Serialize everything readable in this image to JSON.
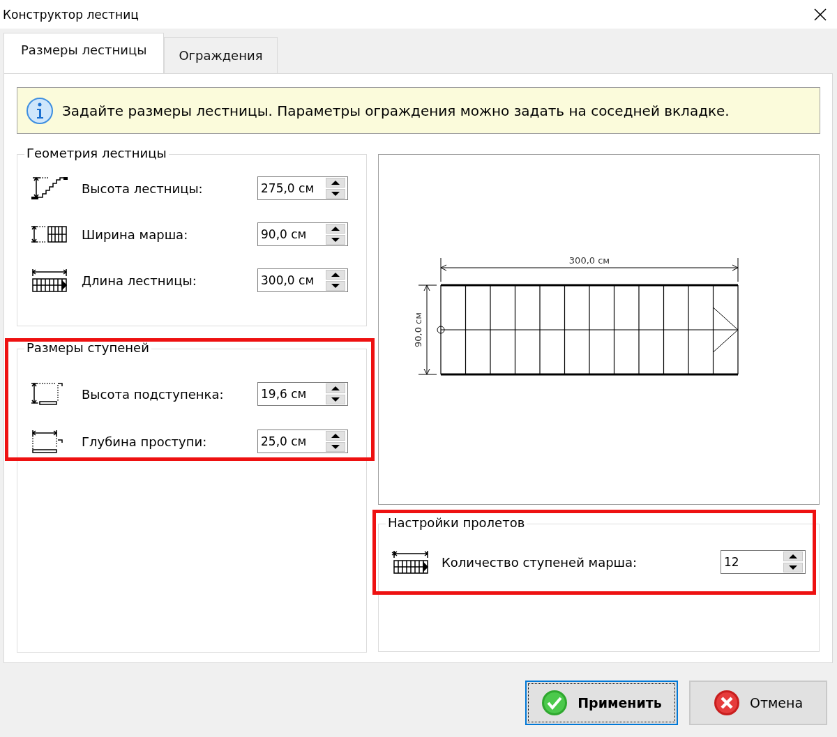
{
  "window": {
    "title": "Конструктор лестниц"
  },
  "tabs": [
    {
      "label": "Размеры лестницы",
      "selected": true
    },
    {
      "label": "Ограждения",
      "selected": false
    }
  ],
  "info": {
    "text": "Задайте размеры лестницы. Параметры ограждения можно задать на соседней вкладке."
  },
  "geometry": {
    "title": "Геометрия лестницы",
    "highlighted": false,
    "fields": [
      {
        "kind": "stair-height",
        "label": "Высота лестницы:",
        "value": "275,0 см"
      },
      {
        "kind": "flight-width",
        "label": "Ширина марша:",
        "value": "90,0 см"
      },
      {
        "kind": "stair-length",
        "label": "Длина лестницы:",
        "value": "300,0 см"
      }
    ]
  },
  "steps": {
    "title": "Размеры ступеней",
    "highlighted": true,
    "fields": [
      {
        "kind": "riser-height",
        "label": "Высота подступенка:",
        "value": "19,6 см"
      },
      {
        "kind": "tread-depth",
        "label": "Глубина проступи:",
        "value": "25,0 см"
      }
    ]
  },
  "preview": {
    "length_label": "300,0 см",
    "width_label": "90,0 см"
  },
  "flights": {
    "title": "Настройки пролетов",
    "highlighted": true,
    "fields": [
      {
        "kind": "step-count",
        "label": "Количество ступеней марша:",
        "value": "12"
      }
    ]
  },
  "buttons": [
    {
      "kind": "apply",
      "label": "Применить",
      "focused": true
    },
    {
      "kind": "cancel",
      "label": "Отмена",
      "focused": false
    }
  ]
}
